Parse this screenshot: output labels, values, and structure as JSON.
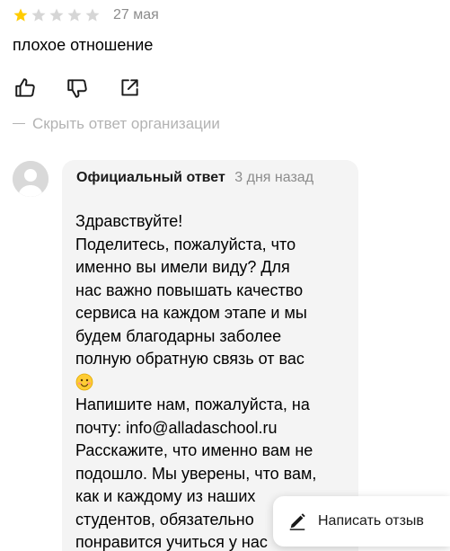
{
  "review": {
    "rating": 1,
    "max_rating": 5,
    "star_filled_color": "#ffcc00",
    "star_empty_color": "#d6d6d6",
    "date": "27 мая",
    "text": "плохое отношение"
  },
  "actions": {
    "like_icon": "thumbs-up-icon",
    "dislike_icon": "thumbs-down-icon",
    "share_icon": "share-icon"
  },
  "org_answer_toggle": {
    "label": "Скрыть ответ организации"
  },
  "org_answer": {
    "author": "Официальный ответ",
    "time": "3 дня назад",
    "lines": [
      "Здравствуйте!",
      "Поделитесь, пожалуйста, что",
      "именно вы имели виду? Для",
      "нас важно повышать качество",
      "сервиса на каждом этапе и мы",
      "будем благодарны заболее",
      "полную обратную связь от вас",
      "",
      "Напишите нам, пожалуйста, на",
      "почту: info@alladaschool.ru",
      "Расскажите, что именно вам не",
      "подошло. Мы уверены, что вам,",
      "как и каждому из наших",
      "студентов, обязательно",
      "понравится учиться у нас"
    ],
    "emoji": "blushing-smile-emoji"
  },
  "write_review": {
    "label": "Написать отзыв",
    "icon": "pencil-icon"
  }
}
